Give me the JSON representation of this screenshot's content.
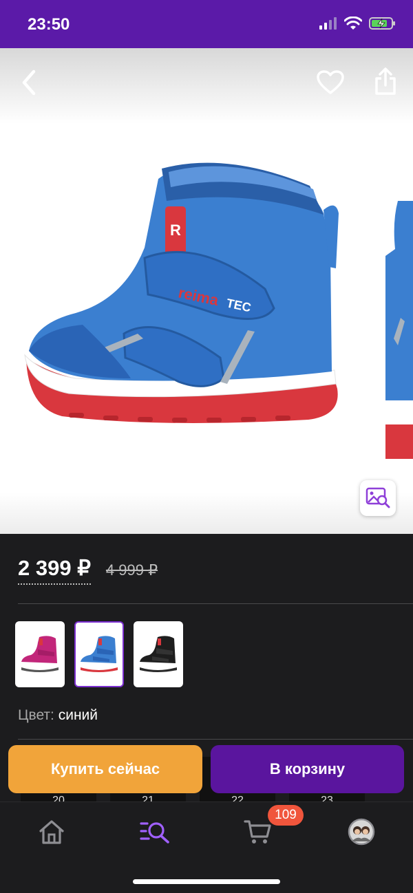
{
  "status_bar": {
    "time": "23:50"
  },
  "product": {
    "price_current": "2 399 ₽",
    "price_old": "4 999 ₽",
    "logo_text": "reima",
    "logo_suffix": "TEC"
  },
  "color": {
    "label": "Цвет:",
    "value": "синий"
  },
  "variants": [
    {
      "name": "pink"
    },
    {
      "name": "blue",
      "selected": true
    },
    {
      "name": "black"
    }
  ],
  "sizes": [
    "20",
    "21",
    "22",
    "23"
  ],
  "actions": {
    "buy_now": "Купить сейчас",
    "add_to_cart": "В корзину"
  },
  "tabbar": {
    "cart_badge": "109"
  },
  "colors": {
    "header": "#5b1aa8",
    "buy_button": "#f1a43a",
    "cart_button": "#5a159e",
    "badge": "#f0553c",
    "accent": "#a060ff"
  }
}
